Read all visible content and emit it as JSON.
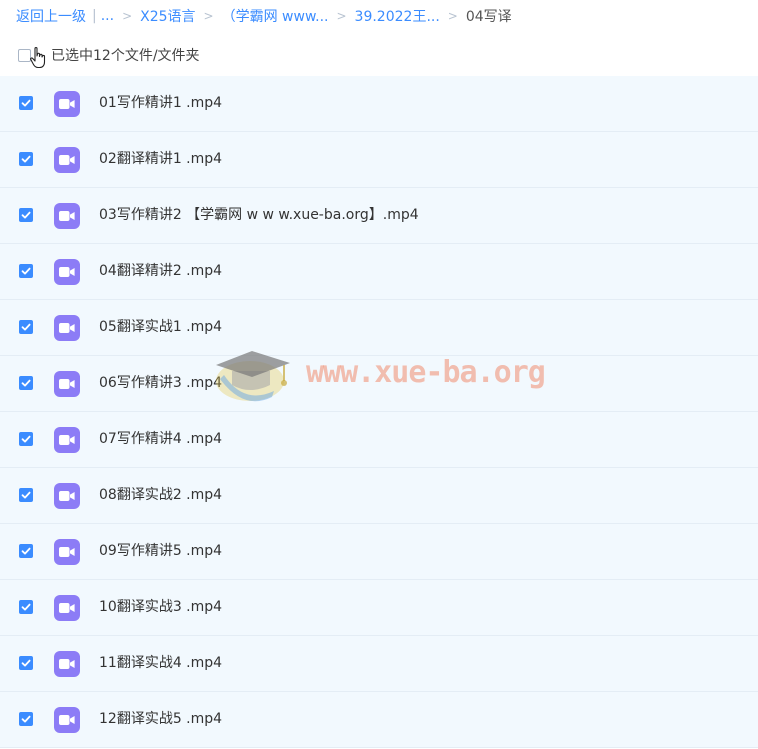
{
  "breadcrumb": {
    "back_label": "返回上一级",
    "pipe": "|",
    "ellipsis": "...",
    "separator": ">",
    "items": [
      "X25语言",
      "（学霸网 www...",
      "39.2022王..."
    ],
    "current": "04写译"
  },
  "selection": {
    "text": "已选中12个文件/文件夹"
  },
  "files": [
    {
      "name": "01写作精讲1 .mp4",
      "checked": true
    },
    {
      "name": "02翻译精讲1 .mp4",
      "checked": true
    },
    {
      "name": "03写作精讲2 【学霸网 w w w.xue-ba.org】.mp4",
      "checked": true
    },
    {
      "name": "04翻译精讲2 .mp4",
      "checked": true
    },
    {
      "name": "05翻译实战1 .mp4",
      "checked": true
    },
    {
      "name": "06写作精讲3 .mp4",
      "checked": true
    },
    {
      "name": "07写作精讲4 .mp4",
      "checked": true
    },
    {
      "name": "08翻译实战2 .mp4",
      "checked": true
    },
    {
      "name": "09写作精讲5 .mp4",
      "checked": true
    },
    {
      "name": "10翻译实战3 .mp4",
      "checked": true
    },
    {
      "name": "11翻译实战4 .mp4",
      "checked": true
    },
    {
      "name": "12翻译实战5 .mp4",
      "checked": true
    }
  ],
  "watermark": {
    "text": "www.xue-ba.org"
  },
  "icons": {
    "file": "video-file-icon",
    "check": "checkmark-icon"
  },
  "colors": {
    "accent": "#3b8cff",
    "video_icon": "#8c7cf6",
    "row_bg": "#f2f9fe"
  }
}
